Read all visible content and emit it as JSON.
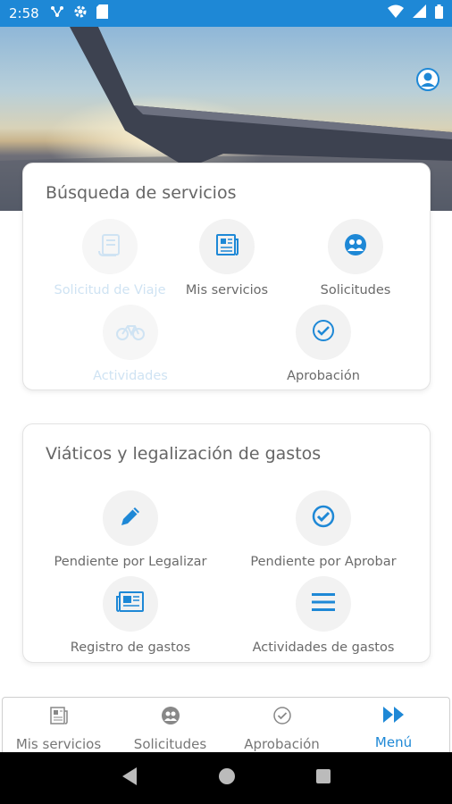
{
  "status_bar": {
    "time": "2:58"
  },
  "card_busqueda": {
    "title": "Búsqueda de servicios",
    "items": [
      {
        "label": "Solicitud de Viaje",
        "icon": "scroll-icon",
        "disabled": true
      },
      {
        "label": "Mis servicios",
        "icon": "newspaper-icon",
        "disabled": false
      },
      {
        "label": "Solicitudes",
        "icon": "group-icon",
        "disabled": false
      },
      {
        "label": "Actividades",
        "icon": "bicycle-icon",
        "disabled": true
      },
      {
        "label": "Aprobación",
        "icon": "check-circle-icon",
        "disabled": false
      }
    ]
  },
  "card_viaticos": {
    "title": "Viáticos y legalización de gastos",
    "items": [
      {
        "label": "Pendiente por Legalizar",
        "icon": "pencil-icon"
      },
      {
        "label": "Pendiente por Aprobar",
        "icon": "check-circle-icon"
      },
      {
        "label": "Registro de gastos",
        "icon": "newspaper-icon"
      },
      {
        "label": "Actividades de gastos",
        "icon": "list-icon"
      }
    ]
  },
  "bottom_nav": {
    "items": [
      {
        "label": "Mis servicios",
        "icon": "newspaper-icon"
      },
      {
        "label": "Solicitudes",
        "icon": "group-icon"
      },
      {
        "label": "Aprobación",
        "icon": "check-circle-icon"
      },
      {
        "label": "Menú",
        "icon": "fast-forward-icon",
        "active": true
      }
    ]
  },
  "colors": {
    "accent": "#1e88d6",
    "disabled": "#cfe3f3",
    "text": "#6a6a6a"
  }
}
